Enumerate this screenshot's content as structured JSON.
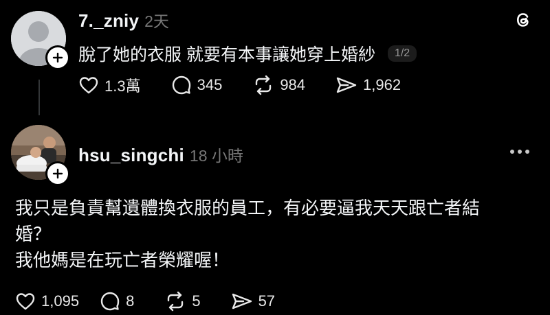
{
  "post1": {
    "username": "7._zniy",
    "time": "2天",
    "text": "脫了她的衣服 就要有本事讓她穿上婚紗",
    "pager": "1/2",
    "likes": "1.3萬",
    "comments": "345",
    "reposts": "984",
    "shares": "1,962"
  },
  "post2": {
    "username": "hsu_singchi",
    "time": "18 小時",
    "line1": "我只是負責幫遺體換衣服的員工，有必要逼我天天跟亡者結",
    "line2": "婚？",
    "line3": "我他媽是在玩亡者榮耀喔！",
    "likes": "1,095",
    "comments": "8",
    "reposts": "5",
    "shares": "57"
  }
}
